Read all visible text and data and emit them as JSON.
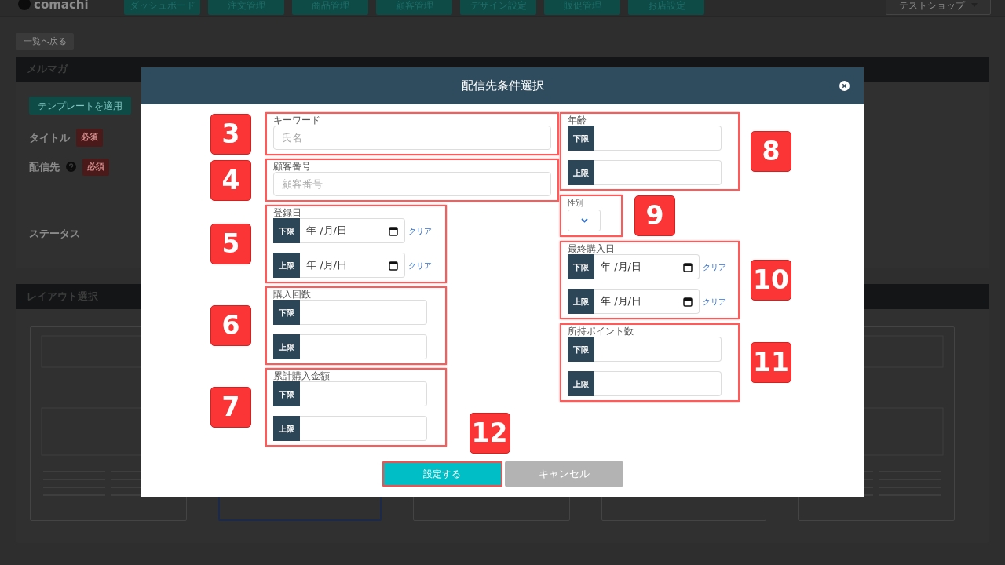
{
  "header": {
    "logo": "comachi",
    "nav": [
      "ダッシュボード",
      "注文管理",
      "商品管理",
      "顧客管理",
      "デザイン設定",
      "販促管理",
      "お店設定"
    ],
    "shop_menu": "テストショップ"
  },
  "back_button": "一覧へ戻る",
  "mail_card": {
    "title": "メルマガ",
    "template_button": "テンプレートを適用",
    "fields": [
      {
        "label": "タイトル",
        "required_badge": "必須",
        "help": false
      },
      {
        "label": "配信先",
        "required_badge": "必須",
        "help": true
      },
      {
        "label": "ステータス"
      }
    ]
  },
  "layout_card": {
    "title": "レイアウト選択",
    "thumbnails": [
      {
        "selected": false
      },
      {
        "selected": true
      },
      {
        "selected": false
      },
      {
        "selected": false
      },
      {
        "selected": false
      }
    ]
  },
  "modal": {
    "title": "配信先条件選択",
    "left_groups": [
      {
        "kind": "text",
        "label": "キーワード",
        "placeholder": "氏名",
        "annotation": "3"
      },
      {
        "kind": "text",
        "label": "顧客番号",
        "placeholder": "顧客番号",
        "annotation": "4"
      },
      {
        "kind": "date_range",
        "label": "登録日",
        "rows": [
          {
            "addon": "下限",
            "placeholder": "年 /月/日",
            "clear_link": "クリア"
          },
          {
            "addon": "上限",
            "placeholder": "年 /月/日",
            "clear_link": "クリア"
          }
        ],
        "annotation": "5"
      },
      {
        "kind": "range",
        "label": "購入回数",
        "rows": [
          {
            "addon": "下限"
          },
          {
            "addon": "上限"
          }
        ],
        "annotation": "6"
      },
      {
        "kind": "range",
        "label": "累計購入金額",
        "rows": [
          {
            "addon": "下限"
          },
          {
            "addon": "上限"
          }
        ],
        "annotation": "7"
      }
    ],
    "right_groups": [
      {
        "kind": "range",
        "label": "年齢",
        "rows": [
          {
            "addon": "下限"
          },
          {
            "addon": "上限"
          }
        ],
        "annotation": "8"
      },
      {
        "kind": "select",
        "label": "性別",
        "annotation": "9"
      },
      {
        "kind": "date_range",
        "label": "最終購入日",
        "rows": [
          {
            "addon": "下限",
            "placeholder": "年 /月/日",
            "clear_link": "クリア"
          },
          {
            "addon": "上限",
            "placeholder": "年 /月/日",
            "clear_link": "クリア"
          }
        ],
        "annotation": "10"
      },
      {
        "kind": "range",
        "label": "所持ポイント数",
        "rows": [
          {
            "addon": "下限"
          },
          {
            "addon": "上限"
          }
        ],
        "annotation": "11"
      }
    ],
    "buttons": [
      {
        "label": "設定する",
        "kind": "primary",
        "annotation": "12"
      },
      {
        "label": "キャンセル",
        "kind": "secondary"
      }
    ]
  }
}
